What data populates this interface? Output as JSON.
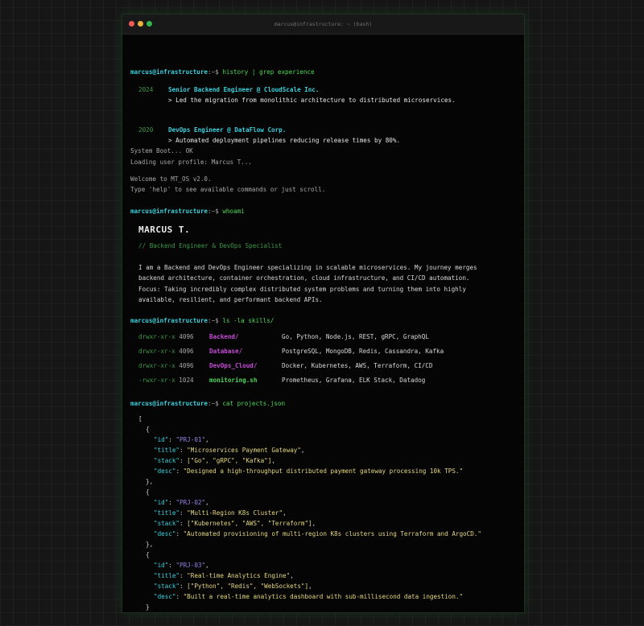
{
  "window": {
    "title": "marcus@infrastructure: ~ (bash)"
  },
  "prompt": {
    "user": "marcus@infrastructure",
    "sep": ":~$"
  },
  "commands": {
    "history": "history | grep experience",
    "whoami": "whoami",
    "ls": "ls -la skills/",
    "cat": "cat projects.json"
  },
  "experience": [
    {
      "year": "2024",
      "title": "Senior Backend Engineer @ CloudScale Inc.",
      "detail": "> Led the migration from monolithic architecture to distributed microservices."
    },
    {
      "year": "2020",
      "title": "DevOps Engineer @ DataFlow Corp.",
      "detail": "> Automated deployment pipelines reducing release times by 80%."
    }
  ],
  "boot": {
    "line1": "System Boot... OK",
    "line2": "Loading user profile: Marcus T...",
    "welcome": "Welcome to MT_OS v2.0.",
    "help": "Type 'help' to see available commands or just scroll."
  },
  "profile": {
    "name": "MARCUS T.",
    "tagline": "// Backend Engineer & DevOps Specialist",
    "bio": [
      "I am a Backend and DevOps Engineer specializing in scalable microservices. My journey merges",
      "backend architecture, container orchestration, cloud infrastructure, and CI/CD automation.",
      "Focus: Taking incredibly complex distributed system problems and turning them into highly",
      "available, resilient, and performant backend APIs."
    ]
  },
  "skills": [
    {
      "perm": "drwxr-xr-x",
      "size": "4096",
      "name": "Backend/",
      "kind": "dir",
      "list": "Go, Python, Node.js, REST, gRPC, GraphQL"
    },
    {
      "perm": "drwxr-xr-x",
      "size": "4096",
      "name": "Database/",
      "kind": "dir",
      "list": "PostgreSQL, MongoDB, Redis, Cassandra, Kafka"
    },
    {
      "perm": "drwxr-xr-x",
      "size": "4096",
      "name": "DevOps_Cloud/",
      "kind": "dir",
      "list": "Docker, Kubernetes, AWS, Terraform, CI/CD"
    },
    {
      "perm": "-rwxr-xr-x",
      "size": "1024",
      "name": "monitoring.sh",
      "kind": "file",
      "list": "Prometheus, Grafana, ELK Stack, Datadog"
    }
  ],
  "projects": [
    {
      "id": "PRJ-01",
      "title": "Microservices Payment Gateway",
      "stack": "[\"Go\", \"gRPC\", \"Kafka\"]",
      "desc": "Designed a high-throughput distributed payment gateway processing 10k TPS."
    },
    {
      "id": "PRJ-02",
      "title": "Multi-Region K8s Cluster",
      "stack": "[\"Kubernetes\", \"AWS\", \"Terraform\"]",
      "desc": "Automated provisioning of multi-region K8s clusters using Terraform and ArgoCD."
    },
    {
      "id": "PRJ-03",
      "title": "Real-time Analytics Engine",
      "stack": "[\"Python\", \"Redis\", \"WebSockets\"]",
      "desc": "Built a real-time analytics dashboard with sub-millisecond data ingestion."
    }
  ],
  "json_syntax": {
    "open_arr": "[",
    "close_arr": "]",
    "open_obj": "{",
    "close_obj": "},",
    "close_obj_last": "}",
    "k_id": "\"id\"",
    "k_title": "\"title\"",
    "k_stack": "\"stack\"",
    "k_desc": "\"desc\"",
    "colon": ": ",
    "comma": ","
  },
  "colors": {
    "prompt_user": "#39d1de",
    "command": "#4ed957",
    "directory": "#c74ad8",
    "string": "#e5d87e",
    "id_value": "#9b80e6"
  }
}
